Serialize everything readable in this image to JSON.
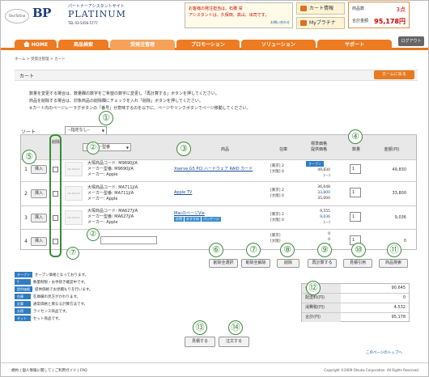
{
  "header": {
    "logo_small": "OneToOne",
    "logo_bp": "BP",
    "logo_sub": "パートナーアシスタントサイト",
    "logo_platinum": "PLATINUM",
    "tel": "TEL 03-5456-5777",
    "notice_lines": [
      "お客様の発注担当は、石橋 栄",
      "アシスタントは、久保田、高山、出司です。"
    ],
    "notice_link": "お問い合わせ",
    "cart_button": "カート情報",
    "my_button": "Myプラチナ",
    "cart_count_label": "商品数",
    "cart_count": "3点",
    "cart_total_label": "合計金額",
    "cart_total": "95,178円"
  },
  "nav": {
    "tabs": [
      "HOME",
      "商品検索",
      "受発注管理",
      "プロモーション",
      "ソリューション",
      "サポート"
    ],
    "logout": "ログアウト"
  },
  "breadcrumb": "ホーム > 受発注管理 > カート",
  "page": {
    "title": "カート",
    "top_link": "ホームに戻る",
    "desc": [
      "数量を変更する場合は、数量欄の数字をご希望の数字に変更し「再計算する」ボタンを押してください。",
      "商品を削除する場合は、対象商品の削除欄にチェックを入れ「削除」ボタンを押してください。",
      "※カート内のページレーラグボタンの「番号」が意味するのを以下に、ページやリンクボタンでページ移動してください。"
    ],
    "sort_label": "ソート",
    "sort_value": "--指定なし--"
  },
  "table": {
    "headers": {
      "del": "削除",
      "maker": "メーカー型番",
      "product": "商品",
      "stock": "在庫",
      "price": "標準価格\n提供価格",
      "qty": "数量",
      "amount": "金額(円)"
    },
    "rows": [
      {
        "num": "1",
        "add": "挿入",
        "thumb": "NO IMAGE",
        "info": [
          "大塚商品コード: M9690J/A",
          "メーカー型番: M9690J/A",
          "メーカー: Apple"
        ],
        "name": "Xserve G5 PCI ハードウェア RAID カード",
        "stock": [
          "[東京] 2",
          "[大阪] 0"
        ],
        "price_tag": "オープン",
        "price": [
          "49,830",
          "(---)"
        ],
        "qty": "1",
        "amount": "49,830"
      },
      {
        "num": "2",
        "add": "挿入",
        "thumb": "NO IMAGE",
        "info": [
          "大塚商品コード: MA711J/A",
          "メーカー型番: MA711J/A",
          "メーカー: Apple"
        ],
        "name": "Apple TV",
        "stock": [
          "[東京] 2",
          "[大阪] 0"
        ],
        "price": [
          "36,648",
          "33,800",
          "35,000"
        ],
        "qty": "1",
        "amount": "33,800"
      },
      {
        "num": "3",
        "add": "挿入",
        "thumb": "NO IMAGE",
        "info": [
          "大塚商品コード: MA627J/A",
          "メーカー型番: MA627J/A",
          "メーカー: Apple"
        ],
        "name": "MacのページVie",
        "stock": [
          "[東京] 2",
          "[大阪] 0"
        ],
        "price": [
          "9,555",
          "9,036",
          "(---)"
        ],
        "qty": "1",
        "amount": "9,036"
      },
      {
        "num": "4",
        "add": "挿入",
        "stock": [
          "[東京]",
          "[大阪]"
        ],
        "price": [
          "0",
          "0",
          "(---)"
        ],
        "qty": "1",
        "amount": "0"
      }
    ],
    "tags": [
      "お得",
      "おすすめ",
      "パッケージ"
    ]
  },
  "actions": {
    "del_all": "削除全選択",
    "del_cancel": "削除全解除",
    "delete": "削除",
    "recalc": "再計算する",
    "quote": "見積引用",
    "search": "商品検索"
  },
  "legend": [
    {
      "tag": "オープン",
      "text": "オープン価格となっております。"
    },
    {
      "tag": "Y",
      "text": "数量制限・お手続き確認中です。"
    },
    {
      "tag": "提供価格",
      "text": "提供価格でお見積もりを行います。"
    },
    {
      "tag": "在庫",
      "text": "在庫欄の見方がかわります。"
    },
    {
      "tag": "計算",
      "text": "通常価格と異なる計算方法です。"
    },
    {
      "tag": "お得",
      "text": "ライセンス商品です。"
    },
    {
      "tag": "セット",
      "text": "セット商品です。"
    }
  ],
  "summary": [
    {
      "k": "小計(円)",
      "v": "90,645"
    },
    {
      "k": "配送料(円)",
      "v": "0"
    },
    {
      "k": "消費税(円)",
      "v": "4,532"
    },
    {
      "k": "合計(円)",
      "v": "95,178"
    }
  ],
  "bottom": {
    "estimate": "見積する",
    "order": "注文する",
    "prev": "このページのトップへ"
  },
  "footer": {
    "links": "規約 | 個人情報に関して | ご利用ガイド | FAQ",
    "copy": "Copyright ©2009 Otsuka Corporation. All Rights Reserved."
  },
  "markers": [
    "①",
    "②",
    "③",
    "④",
    "⑤",
    "⑥",
    "⑦",
    "⑧",
    "⑨",
    "⑩",
    "⑪",
    "⑫",
    "⑬",
    "⑭"
  ]
}
